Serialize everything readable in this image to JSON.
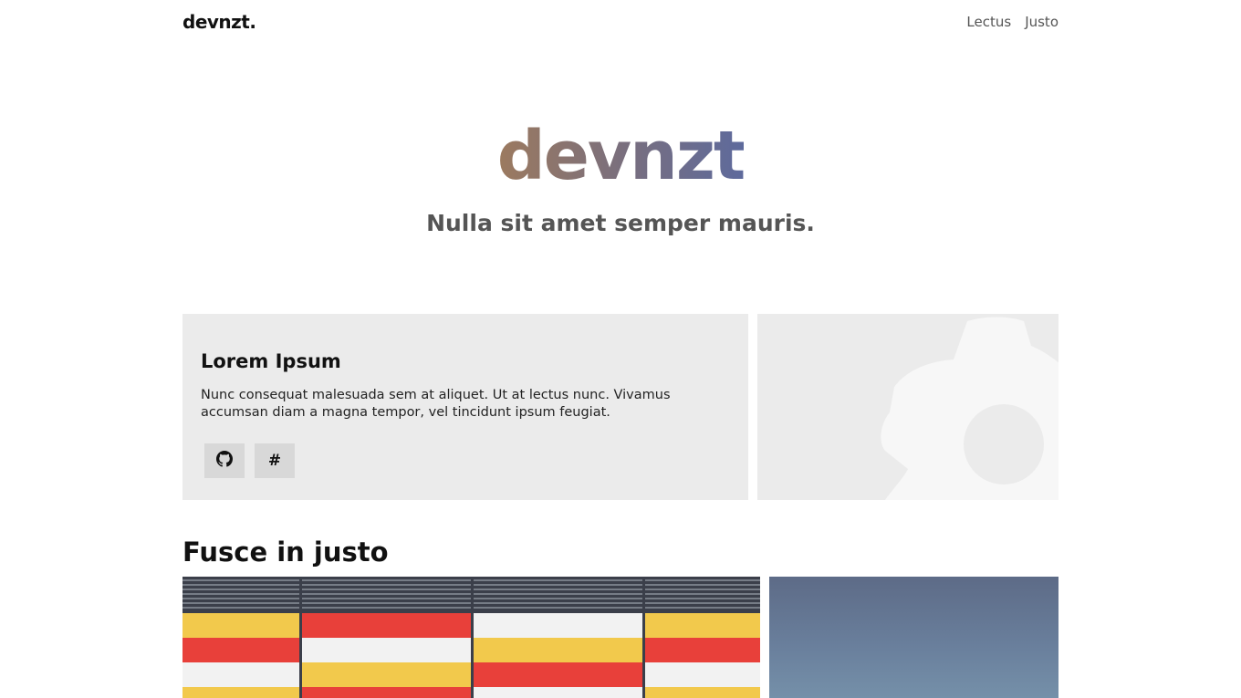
{
  "header": {
    "logo": "devnzt.",
    "nav": [
      "Lectus",
      "Justo"
    ]
  },
  "hero": {
    "title": "devnzt",
    "subtitle": "Nulla sit amet semper mauris."
  },
  "card": {
    "title": "Lorem Ipsum",
    "description": "Nunc consequat malesuada sem at aliquet. Ut at lectus nunc. Vivamus accumsan diam a magna tempor, vel tincidunt ipsum feugiat.",
    "buttons": [
      {
        "icon": "github-icon"
      },
      {
        "label": "#"
      }
    ],
    "side_icon": "gear-icon"
  },
  "section": {
    "title": "Fusce in justo"
  },
  "colors": {
    "gradient_start": "#9c7a5f",
    "gradient_end": "#5e6a9c",
    "card_bg": "#ebebeb",
    "button_bg": "#d8d8d8"
  }
}
